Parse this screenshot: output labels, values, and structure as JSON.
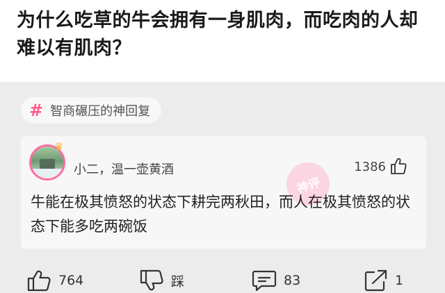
{
  "question": {
    "title": "为什么吃草的牛会拥有一身肌肉，而吃肉的人却难以有肌肉？"
  },
  "topic": {
    "icon": "hash-icon",
    "label": "智商碾压的神回复"
  },
  "comment": {
    "username": "小二，温一壶黄酒",
    "likes": "1386",
    "stamp_text": "神评",
    "text": "牛能在极其愤怒的状态下耕完两秋田，而人在极其愤怒的状态下能多吃两碗饭"
  },
  "actions": {
    "like_count": "764",
    "dislike_label": "踩",
    "comment_count": "83",
    "share_count": "1"
  },
  "colors": {
    "accent": "#ff5a8a",
    "background": "#ececec",
    "card": "#f7f7f7"
  }
}
